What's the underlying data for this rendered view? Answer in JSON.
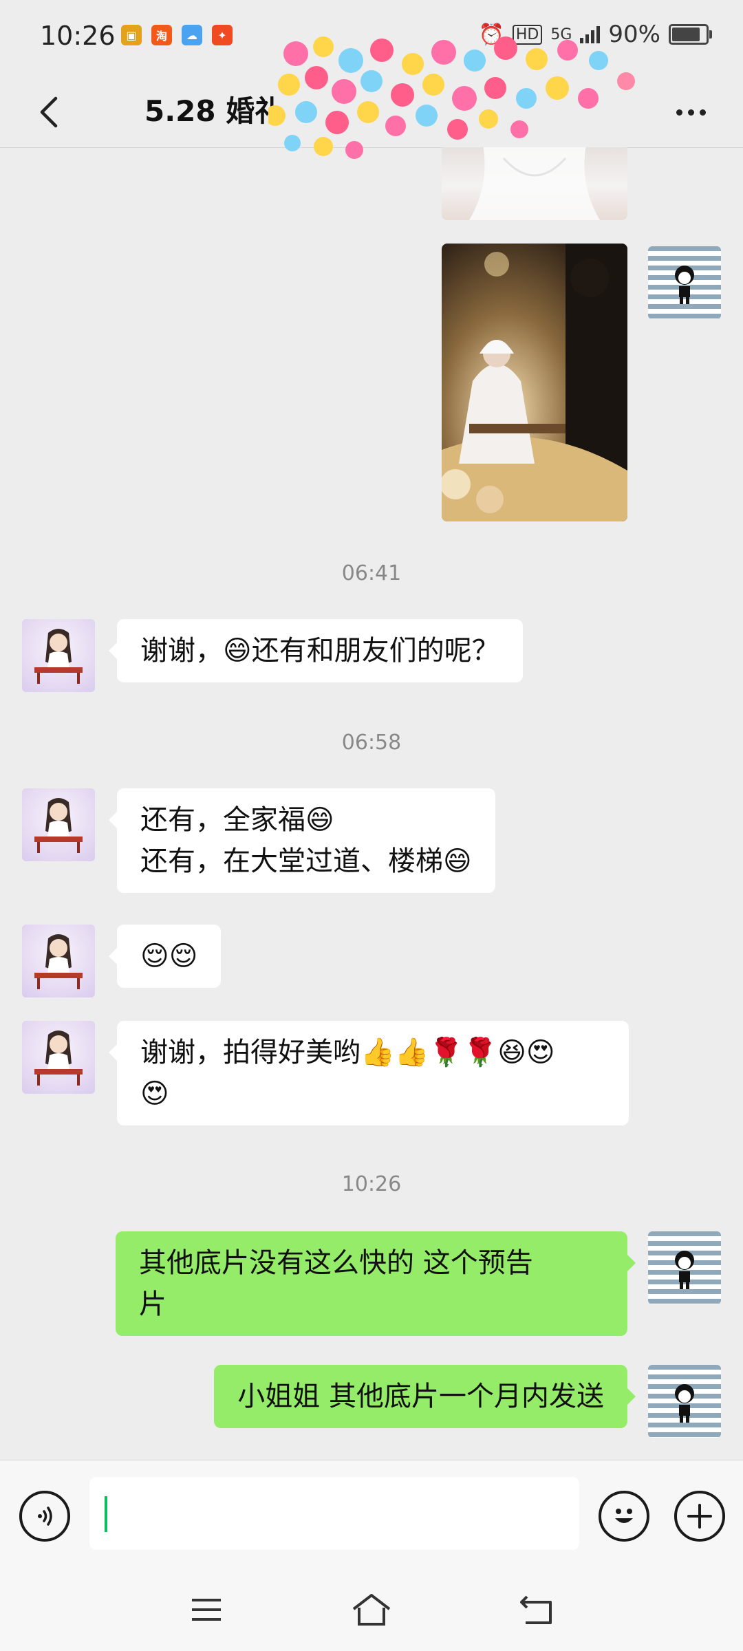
{
  "status_bar": {
    "time": "10:26",
    "battery": "90%",
    "network": "5G",
    "battery_level": 0.9
  },
  "header": {
    "title": "5.28 婚礼"
  },
  "messages": [
    {
      "kind": "image",
      "side": "right",
      "desc": "wedding-dress-photo"
    },
    {
      "kind": "image",
      "side": "right",
      "desc": "bride-playing-guzheng-photo"
    },
    {
      "kind": "time",
      "text": "06:41"
    },
    {
      "kind": "text",
      "side": "left",
      "text": "谢谢，😄还有和朋友们的呢？"
    },
    {
      "kind": "time",
      "text": "06:58"
    },
    {
      "kind": "text",
      "side": "left",
      "text": "还有，全家福😄\n还有，在大堂过道、楼梯😄"
    },
    {
      "kind": "text",
      "side": "left",
      "text": "😌😌"
    },
    {
      "kind": "text",
      "side": "left",
      "text": "谢谢，拍得好美哟👍👍🌹🌹😆😍\n😍"
    },
    {
      "kind": "time",
      "text": "10:26"
    },
    {
      "kind": "text",
      "side": "right",
      "text": "其他底片没有这么快的 这个预告\n片"
    },
    {
      "kind": "text",
      "side": "right",
      "text": "小姐姐 其他底片一个月内发送"
    }
  ],
  "input": {
    "value": "",
    "placeholder": ""
  },
  "icons": {
    "back": "chevron-left-icon",
    "more": "more-dots-icon",
    "voice": "voice-icon",
    "emoji": "emoji-icon",
    "plus": "plus-icon",
    "menu": "menu-icon",
    "home": "home-icon",
    "return": "back-icon"
  },
  "colors": {
    "sent_bubble": "#95ec69",
    "received_bubble": "#ffffff",
    "background": "#ededed",
    "cursor": "#07c160"
  }
}
